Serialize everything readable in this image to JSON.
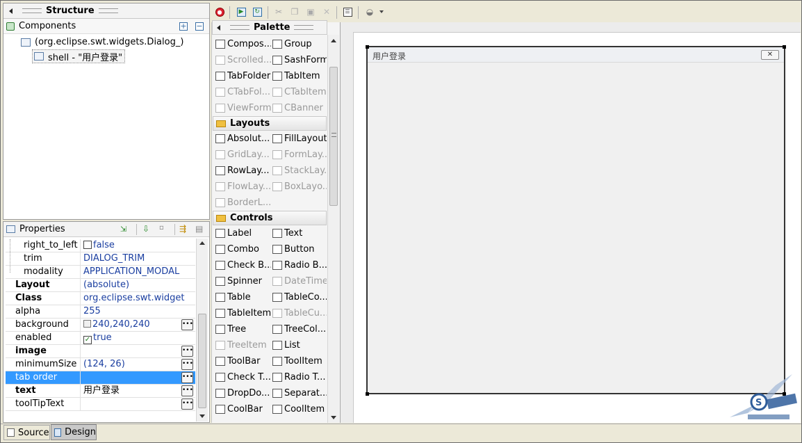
{
  "structure": {
    "title": "Structure",
    "components_label": "Components",
    "tree": [
      {
        "label": "(org.eclipse.swt.widgets.Dialog_)"
      },
      {
        "label": "shell - \"用户登录\""
      }
    ]
  },
  "properties": {
    "title": "Properties",
    "rows": [
      {
        "key": "right_to_left",
        "value": "false",
        "checkbox": false
      },
      {
        "key": "trim",
        "value": "DIALOG_TRIM"
      },
      {
        "key": "modality",
        "value": "APPLICATION_MODAL"
      },
      {
        "key": "Layout",
        "value": "(absolute)"
      },
      {
        "key": "Class",
        "value": "org.eclipse.swt.widgets.Sh..."
      },
      {
        "key": "alpha",
        "value": "255"
      },
      {
        "key": "background",
        "value": "240,240,240",
        "color": "#f0f0f0"
      },
      {
        "key": "enabled",
        "value": "true",
        "checkbox": true
      },
      {
        "key": "image",
        "value": ""
      },
      {
        "key": "minimumSize",
        "value": "(124, 26)"
      },
      {
        "key": "tab order",
        "value": ""
      },
      {
        "key": "text",
        "value": "用户登录"
      },
      {
        "key": "toolTipText",
        "value": ""
      }
    ]
  },
  "palette": {
    "title": "Palette",
    "composites_items": [
      {
        "label": "Compos...",
        "enabled": true
      },
      {
        "label": "Group",
        "enabled": true
      },
      {
        "label": "Scrolled...",
        "enabled": false
      },
      {
        "label": "SashForm",
        "enabled": true
      },
      {
        "label": "TabFolder",
        "enabled": true
      },
      {
        "label": "TabItem",
        "enabled": true
      },
      {
        "label": "CTabFol...",
        "enabled": false
      },
      {
        "label": "CTabItem",
        "enabled": false
      },
      {
        "label": "ViewForm",
        "enabled": false
      },
      {
        "label": "CBanner",
        "enabled": false
      }
    ],
    "layouts_label": "Layouts",
    "layouts_items": [
      {
        "label": "Absolut...",
        "enabled": true
      },
      {
        "label": "FillLayout",
        "enabled": true
      },
      {
        "label": "GridLay...",
        "enabled": false
      },
      {
        "label": "FormLay...",
        "enabled": false
      },
      {
        "label": "RowLay...",
        "enabled": true
      },
      {
        "label": "StackLay...",
        "enabled": false
      },
      {
        "label": "FlowLay...",
        "enabled": false
      },
      {
        "label": "BoxLayo...",
        "enabled": false
      },
      {
        "label": "BorderL...",
        "enabled": false
      }
    ],
    "controls_label": "Controls",
    "controls_items": [
      {
        "label": "Label",
        "enabled": true
      },
      {
        "label": "Text",
        "enabled": true
      },
      {
        "label": "Combo",
        "enabled": true
      },
      {
        "label": "Button",
        "enabled": true
      },
      {
        "label": "Check B...",
        "enabled": true
      },
      {
        "label": "Radio B...",
        "enabled": true
      },
      {
        "label": "Spinner",
        "enabled": true
      },
      {
        "label": "DateTime",
        "enabled": false
      },
      {
        "label": "Table",
        "enabled": true
      },
      {
        "label": "TableCo...",
        "enabled": true
      },
      {
        "label": "TableItem",
        "enabled": true
      },
      {
        "label": "TableCu...",
        "enabled": false
      },
      {
        "label": "Tree",
        "enabled": true
      },
      {
        "label": "TreeCol...",
        "enabled": true
      },
      {
        "label": "TreeItem",
        "enabled": false
      },
      {
        "label": "List",
        "enabled": true
      },
      {
        "label": "ToolBar",
        "enabled": true
      },
      {
        "label": "ToolItem",
        "enabled": true
      },
      {
        "label": "Check T...",
        "enabled": true
      },
      {
        "label": "Radio T...",
        "enabled": true
      },
      {
        "label": "DropDo...",
        "enabled": true
      },
      {
        "label": "Separat...",
        "enabled": true
      },
      {
        "label": "CoolBar",
        "enabled": true
      },
      {
        "label": "CoolItem",
        "enabled": true
      }
    ]
  },
  "design": {
    "shell_title": "用户登录",
    "close_icon": "close-icon"
  },
  "bottom_tabs": [
    {
      "label": "Source",
      "active": false
    },
    {
      "label": "Design",
      "active": true
    }
  ],
  "colors": {
    "selection": "#3399ff",
    "value_text": "#1a3ea0",
    "shell_bg": "#f0f0f0"
  }
}
